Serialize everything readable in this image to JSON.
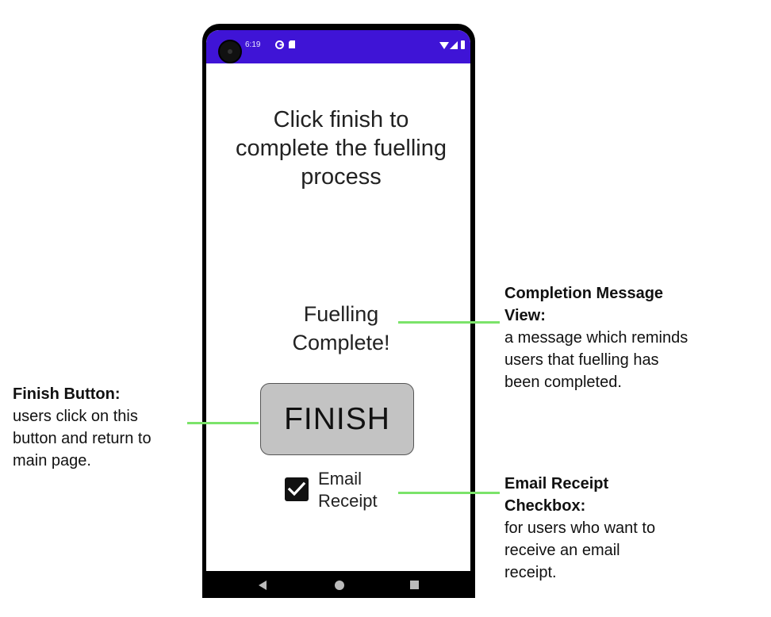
{
  "status_bar": {
    "time": "6:19",
    "icons": [
      "notification-icon",
      "sd-card-icon",
      "wifi-icon",
      "signal-icon",
      "battery-icon"
    ],
    "color": "#3f14d6"
  },
  "screen": {
    "instruction": "Click finish to complete the fuelling process",
    "completion_message": "Fuelling Complete!",
    "finish_button_label": "FINISH",
    "email_checkbox": {
      "label_line1": "Email",
      "label_line2": "Receipt",
      "checked": true
    }
  },
  "nav_bar": {
    "icons": [
      "back-icon",
      "home-icon",
      "recent-apps-icon"
    ]
  },
  "annotations": {
    "completion": {
      "title_line1": "Completion Message",
      "title_line2": "View:",
      "desc_line1": "a message which reminds",
      "desc_line2": "users that fuelling has",
      "desc_line3": "been completed."
    },
    "finish": {
      "title": "Finish Button:",
      "desc_line1": "users click on this",
      "desc_line2": "button and return to",
      "desc_line3": "main page."
    },
    "email": {
      "title_line1": "Email Receipt",
      "title_line2": "Checkbox:",
      "desc_line1": "for users who want to",
      "desc_line2": "receive an email",
      "desc_line3": "receipt."
    },
    "connector_color": "#7be36a"
  }
}
